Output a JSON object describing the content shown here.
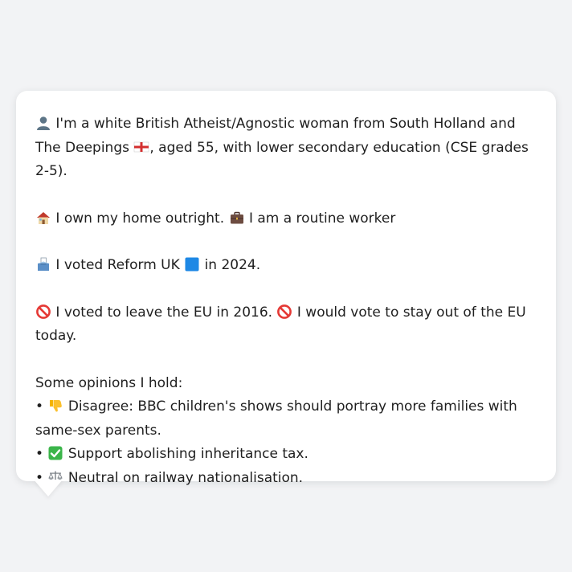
{
  "profile": {
    "identity": {
      "icon": "person-silhouette-icon",
      "text_before_flag": "I'm a white British Atheist/Agnostic woman from South Holland and The Deepings",
      "flag_icon": "england-flag-icon",
      "text_after_flag": ", aged 55, with lower secondary education (CSE grades 2-5)."
    },
    "housing": {
      "home_icon": "house-icon",
      "home_text": "I own my home outright.",
      "work_icon": "briefcase-icon",
      "work_text": "I am a routine worker"
    },
    "vote": {
      "icon": "ballot-box-icon",
      "text_before": "I voted Reform UK",
      "party_icon": "blue-square-icon",
      "text_after": "in 2024."
    },
    "eu": {
      "icon_1": "prohibited-icon",
      "text_1": "I voted to leave the EU in 2016.",
      "icon_2": "prohibited-icon",
      "text_2": "I would vote to stay out of the EU today."
    },
    "opinions": {
      "heading": "Some opinions I hold:",
      "bullet": "•",
      "items": [
        {
          "icon": "thumbs-down-icon",
          "text": "Disagree: BBC children's shows should portray more families with same-sex parents."
        },
        {
          "icon": "check-mark-button-icon",
          "text": "Support abolishing inheritance tax."
        },
        {
          "icon": "balance-scale-icon",
          "text": "Neutral on railway nationalisation."
        }
      ]
    }
  },
  "colors": {
    "background": "#f2f3f5",
    "card": "#ffffff",
    "text": "#1f1f1f",
    "reform_blue": "#1e88e5",
    "check_green": "#3bb54a",
    "prohibited_red": "#e53935"
  }
}
